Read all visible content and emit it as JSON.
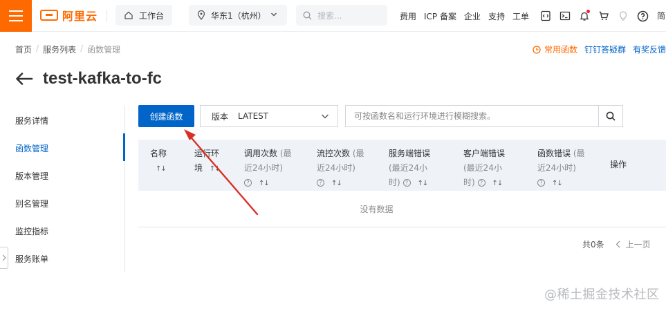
{
  "topbar": {
    "logo_text": "阿里云",
    "workbench_label": "工作台",
    "region_label": "华东1（杭州）",
    "search_placeholder": "搜索...",
    "nav": [
      "费用",
      "ICP 备案",
      "企业",
      "支持",
      "工单"
    ],
    "lang_label": "简",
    "icons": [
      "code-icon",
      "terminal-icon",
      "bell-icon",
      "cart-icon",
      "bulb-icon",
      "help-icon"
    ]
  },
  "breadcrumb": {
    "items": [
      "首页",
      "服务列表",
      "函数管理"
    ],
    "separator": "/"
  },
  "header_links": {
    "common_functions": "常用函数",
    "dingtalk_group": "钉钉答疑群",
    "feedback": "有奖反馈"
  },
  "page": {
    "title": "test-kafka-to-fc"
  },
  "sidemenu": {
    "items": [
      "服务详情",
      "函数管理",
      "版本管理",
      "别名管理",
      "监控指标",
      "服务账单"
    ],
    "active": "函数管理"
  },
  "toolbar": {
    "create_label": "创建函数",
    "version_label": "版本",
    "version_value": "LATEST",
    "search_placeholder": "可按函数名和运行环境进行模糊搜索。"
  },
  "table": {
    "columns": {
      "name": "名称",
      "runtime_1": "运行环",
      "runtime_2": "境",
      "invocations_1": "调用次数",
      "invocations_sub_1": "(最",
      "invocations_2": "近24小时)",
      "throttles_1": "流控次数",
      "throttles_sub_1": "(最",
      "throttles_2": "近24小时)",
      "server_err_1": "服务端错误",
      "server_err_2": "(最近24小",
      "server_err_3": "时)",
      "client_err_1": "客户端错误",
      "client_err_2": "(最近24小",
      "client_err_3": "时)",
      "func_err_1": "函数错误",
      "func_err_sub_1": "(最",
      "func_err_2": "近24小时)",
      "actions": "操作"
    },
    "empty_text": "没有数据"
  },
  "pager": {
    "total": "共0条",
    "prev": "上一页"
  },
  "watermark": "@稀土掘金技术社区",
  "colors": {
    "brand_orange": "#ff6a00",
    "primary_blue": "#0064c8",
    "annotation_red": "#d93025"
  }
}
